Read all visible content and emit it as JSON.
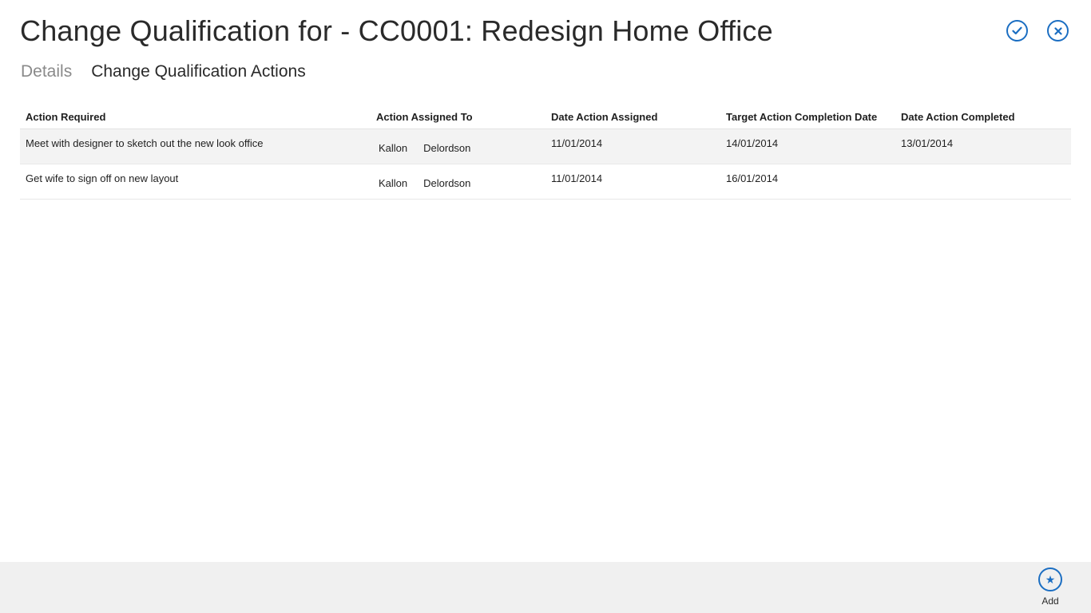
{
  "header": {
    "title": "Change Qualification for - CC0001: Redesign Home Office"
  },
  "actions": {
    "confirm_icon": "check-icon",
    "close_icon": "close-icon"
  },
  "tabs": [
    {
      "label": "Details",
      "active": false
    },
    {
      "label": "Change Qualification Actions",
      "active": true
    }
  ],
  "table": {
    "columns": [
      "Action Required",
      "Action Assigned To",
      "Date Action Assigned",
      "Target Action Completion Date",
      "Date Action Completed"
    ],
    "rows": [
      {
        "action": "Meet with designer to sketch out the new look office",
        "assignee_first": "Kallon",
        "assignee_last": "Delordson",
        "date_assigned": "11/01/2014",
        "target_date": "14/01/2014",
        "date_completed": "13/01/2014"
      },
      {
        "action": "Get wife to sign off on new layout",
        "assignee_first": "Kallon",
        "assignee_last": "Delordson",
        "date_assigned": "11/01/2014",
        "target_date": "16/01/2014",
        "date_completed": ""
      }
    ]
  },
  "appbar": {
    "add_label": "Add",
    "add_icon": "star-icon"
  },
  "colors": {
    "accent": "#1b6ec2",
    "row_shade": "#f3f3f3",
    "appbar_bg": "#f0f0f0"
  }
}
